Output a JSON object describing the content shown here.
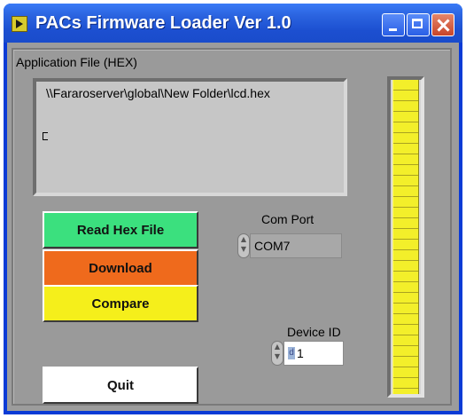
{
  "window": {
    "title": "PACs Firmware Loader Ver 1.0",
    "title_bar_color": "#245edb"
  },
  "application_file": {
    "label": "Application File (HEX)",
    "path": "\\\\Fararoserver\\global\\New Folder\\lcd.hex"
  },
  "buttons": {
    "read_hex": "Read Hex File",
    "download": "Download",
    "compare": "Compare",
    "quit": "Quit"
  },
  "com_port": {
    "label": "Com Port",
    "value": "COM7"
  },
  "device_id": {
    "label": "Device ID",
    "radix": "d",
    "value": "1"
  },
  "progress": {
    "fraction": 1.0,
    "color": "#f3ef2a"
  },
  "colors": {
    "read_hex": "#3be07e",
    "download": "#ef6a1c",
    "compare": "#f5ef1b",
    "quit": "#ffffff"
  },
  "icons": [
    "app-icon",
    "minimize-icon",
    "maximize-icon",
    "close-icon"
  ]
}
